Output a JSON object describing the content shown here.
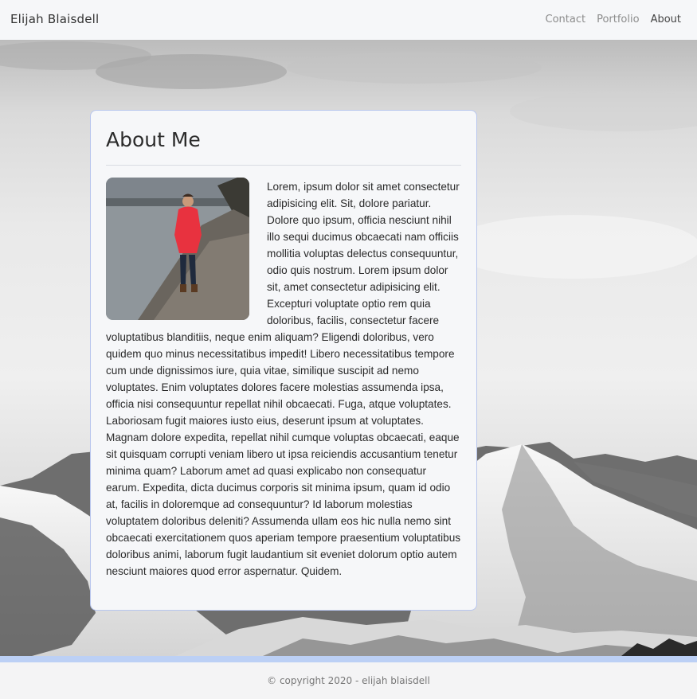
{
  "nav": {
    "brand": "Elijah Blaisdell",
    "links": [
      {
        "label": "Contact"
      },
      {
        "label": "Portfolio"
      },
      {
        "label": "About"
      }
    ]
  },
  "about": {
    "title": "About Me",
    "photo_alt": "Photo of Elijah Blaisdell",
    "bio": "Lorem, ipsum dolor sit amet consectetur adipisicing elit. Sit, dolore pariatur. Dolore quo ipsum, officia nesciunt nihil illo sequi ducimus obcaecati nam officiis mollitia voluptas delectus consequuntur, odio quis nostrum. Lorem ipsum dolor sit, amet consectetur adipisicing elit. Excepturi voluptate optio rem quia doloribus, facilis, consectetur facere voluptatibus blanditiis, neque enim aliquam? Eligendi doloribus, vero quidem quo minus necessitatibus impedit! Libero necessitatibus tempore cum unde dignissimos iure, quia vitae, similique suscipit ad nemo voluptates. Enim voluptates dolores facere molestias assumenda ipsa, officia nisi consequuntur repellat nihil obcaecati. Fuga, atque voluptates. Laboriosam fugit maiores iusto eius, deserunt ipsum at voluptates. Magnam dolore expedita, repellat nihil cumque voluptas obcaecati, eaque sit quisquam corrupti veniam libero ut ipsa reiciendis accusantium tenetur minima quam? Laborum amet ad quasi explicabo non consequatur earum. Expedita, dicta ducimus corporis sit minima ipsum, quam id odio at, facilis in doloremque ad consequuntur? Id laborum molestias voluptatem doloribus deleniti? Assumenda ullam eos hic nulla nemo sint obcaecati exercitationem quos aperiam tempore praesentium voluptatibus doloribus animi, laborum fugit laudantium sit eveniet dolorum optio autem nesciunt maiores quod error aspernatur. Quidem."
  },
  "footer": {
    "text": "© copyright 2020 - elijah blaisdell"
  },
  "colors": {
    "card_border": "#b8c6ee",
    "accent_strip": "#bcd0f5",
    "navbar_bg": "#f6f7f9",
    "jacket": "#e8323f"
  }
}
